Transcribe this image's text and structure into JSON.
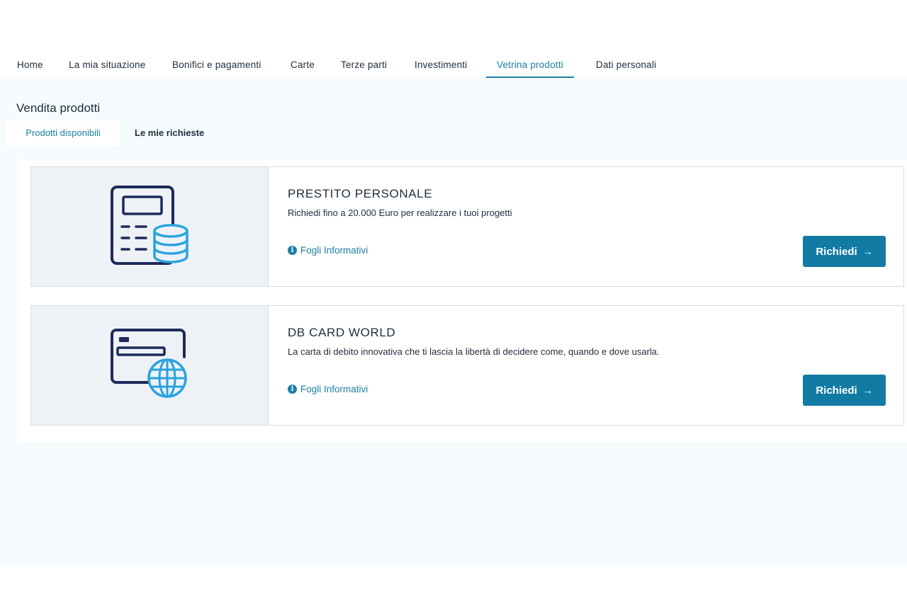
{
  "nav": {
    "items": [
      {
        "label": "Home"
      },
      {
        "label": "La mia situazione"
      },
      {
        "label": "Bonifici e pagamenti"
      },
      {
        "label": "Carte"
      },
      {
        "label": "Terze parti"
      },
      {
        "label": "Investimenti"
      },
      {
        "label": "Vetrina prodotti"
      },
      {
        "label": "Dati personali"
      }
    ],
    "active": "Vetrina prodotti"
  },
  "section": {
    "title": "Vendita prodotti",
    "tabs": [
      {
        "label": "Prodotti disponibili",
        "active": true
      },
      {
        "label": "Le mie richieste",
        "active": false
      }
    ]
  },
  "products": [
    {
      "title": "PRESTITO PERSONALE",
      "description": "Richiedi fino a 20.000 Euro per realizzare i tuoi progetti",
      "info_link": "Fogli Informativi",
      "button": "Richiedi",
      "illustration": "calculator-coins-icon"
    },
    {
      "title": "DB CARD WORLD",
      "description": "La carta di debito innovativa che ti lascia la libertà di decidere come, quando e dove usarla.",
      "info_link": "Fogli Informativi",
      "button": "Richiedi",
      "illustration": "card-globe-icon"
    }
  ],
  "colors": {
    "accent": "#1b7fa3",
    "button": "#127ba3",
    "icon_dark": "#1e2a5a",
    "icon_light": "#2aa3dc",
    "page_bg": "#f6fbfd",
    "media_bg": "#eef2f7"
  }
}
